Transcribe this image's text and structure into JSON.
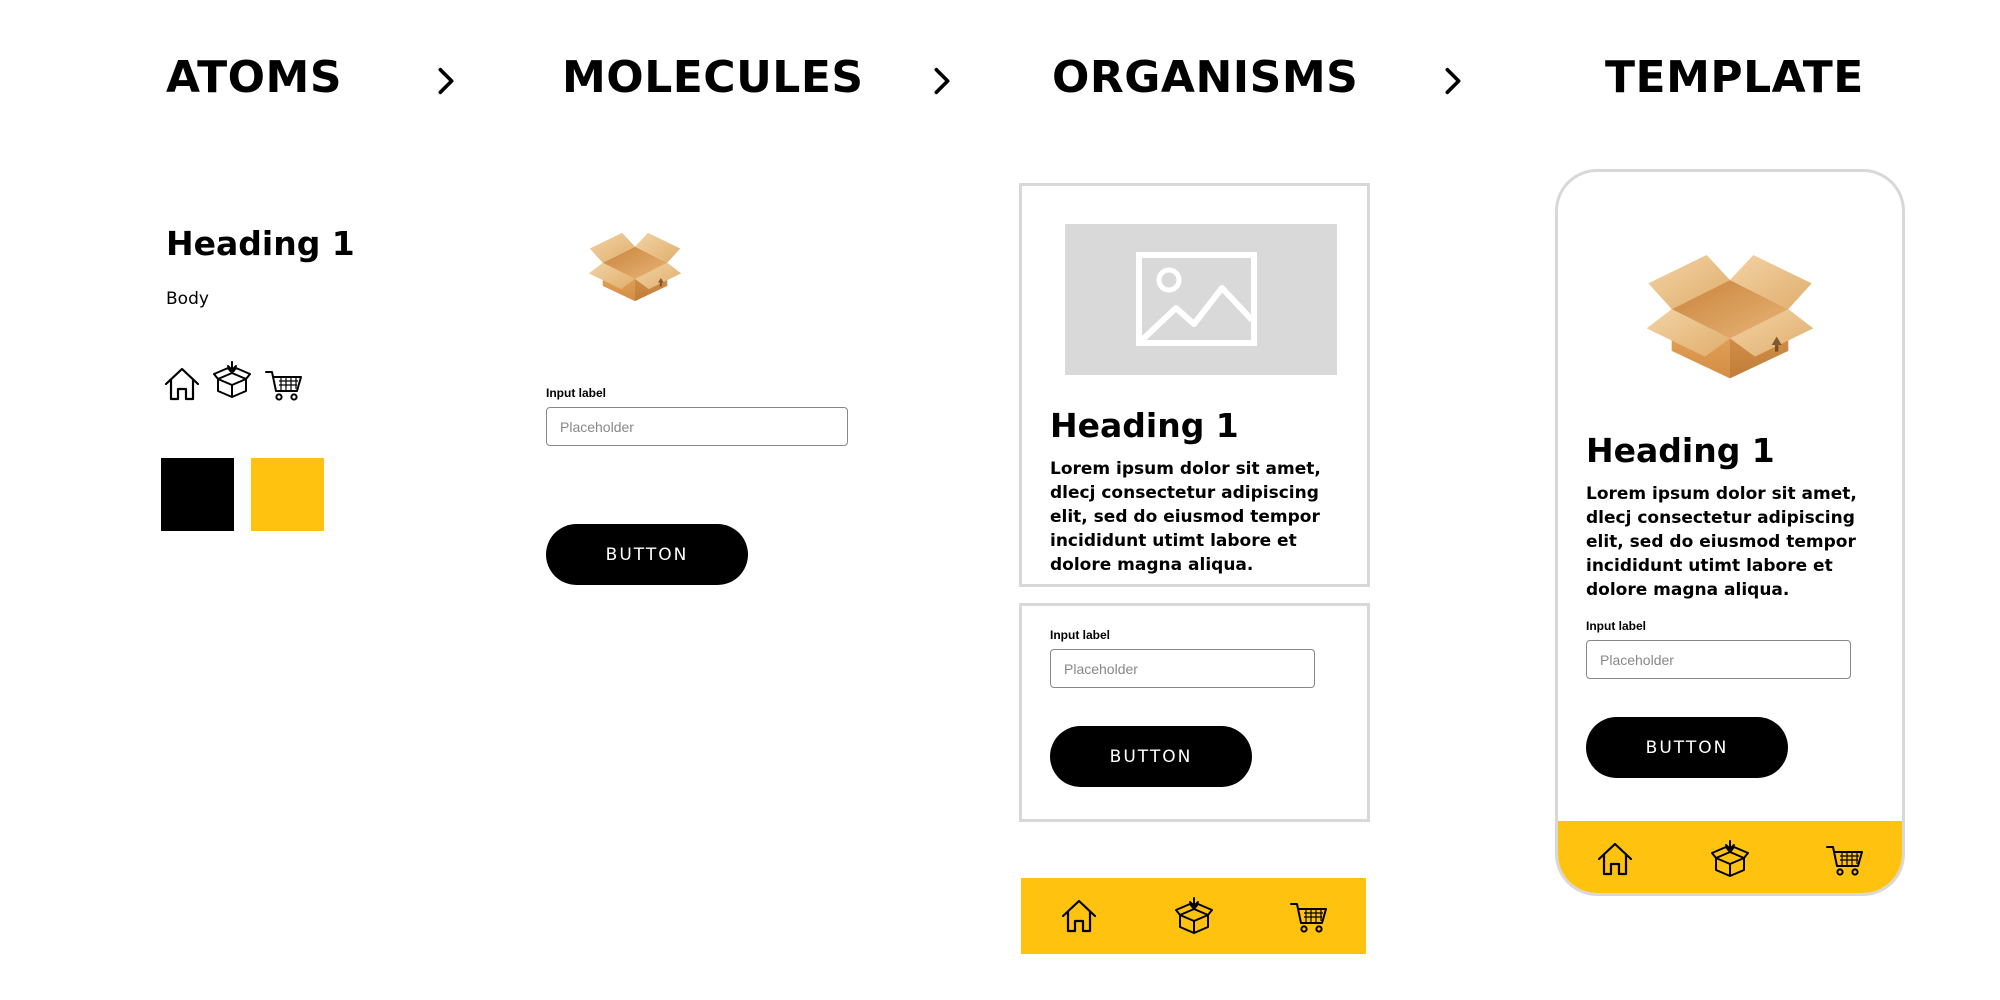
{
  "colors": {
    "accent": "#FFC20E",
    "black": "#000000",
    "image_placeholder": "#D9D9D9",
    "card_border": "#D8D8D8"
  },
  "columns": [
    {
      "title": "ATOMS"
    },
    {
      "title": "MOLECULES"
    },
    {
      "title": "ORGANISMS"
    },
    {
      "title": "TEMPLATE"
    }
  ],
  "atoms": {
    "heading": "Heading 1",
    "body": "Body",
    "icons": [
      "home-icon",
      "box-icon",
      "cart-icon"
    ],
    "swatches": [
      "#000000",
      "#FFC20E"
    ]
  },
  "molecules": {
    "input_label": "Input label",
    "input_placeholder": "Placeholder",
    "button_label": "BUTTON"
  },
  "organisms": {
    "heading": "Heading 1",
    "body": "Lorem ipsum dolor sit amet,  dlecj consectetur adipiscing elit, sed do eiusmod tempor incididunt utimt labore et dolore magna aliqua.",
    "input_label": "Input label",
    "input_placeholder": "Placeholder",
    "button_label": "BUTTON",
    "nav_icons": [
      "home-icon",
      "box-icon",
      "cart-icon"
    ]
  },
  "template": {
    "heading": "Heading 1",
    "body": "Lorem ipsum dolor sit amet,  dlecj consectetur adipiscing elit, sed do eiusmod tempor incididunt utimt labore et dolore magna aliqua.",
    "input_label": "Input label",
    "input_placeholder": "Placeholder",
    "button_label": "BUTTON",
    "nav_icons": [
      "home-icon",
      "box-icon",
      "cart-icon"
    ]
  }
}
